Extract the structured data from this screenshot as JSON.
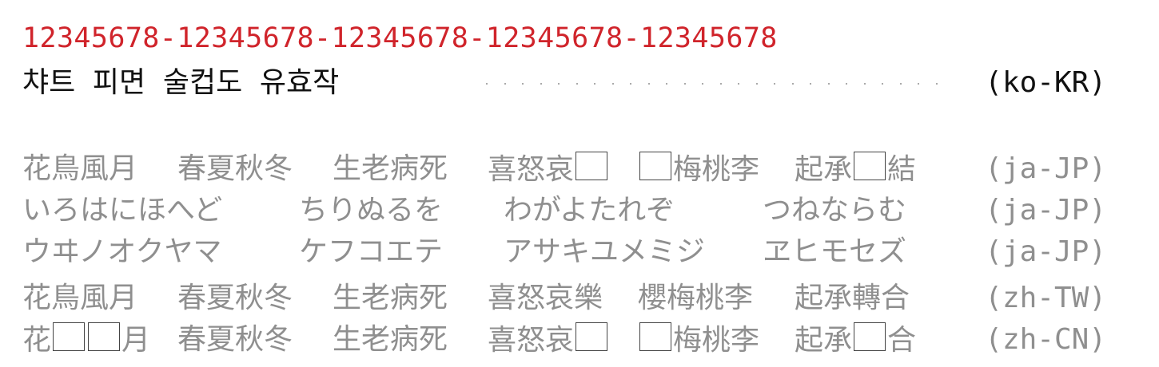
{
  "ruler": "12345678-12345678-12345678-12345678-12345678",
  "korean": {
    "text": "챠트 피면 술컵도 유효작",
    "tag": "(ko-KR)"
  },
  "rows": [
    {
      "segments": [
        "花鳥風月",
        "春夏秋冬",
        "生老病死",
        "喜怒哀[]",
        "[]梅桃李",
        "起承[]結"
      ],
      "tag": "(ja-JP)"
    },
    {
      "segments": [
        "いろはにほへど",
        "ちりぬるを",
        "わがよたれぞ",
        "つねならむ"
      ],
      "tag": "(ja-JP)"
    },
    {
      "segments": [
        "ウヰノオクヤマ",
        "ケフコエテ",
        "アサキユメミジ",
        "ヱヒモセズ"
      ],
      "tag": "(ja-JP)"
    },
    {
      "segments": [
        "花鳥風月",
        "春夏秋冬",
        "生老病死",
        "喜怒哀樂",
        "櫻梅桃李",
        "起承轉合"
      ],
      "tag": "(zh-TW)"
    },
    {
      "segments": [
        "花[][]月",
        "春夏秋冬",
        "生老病死",
        "喜怒哀[]",
        "[]梅桃李",
        "起承[]合"
      ],
      "tag": "(zh-CN)"
    }
  ]
}
